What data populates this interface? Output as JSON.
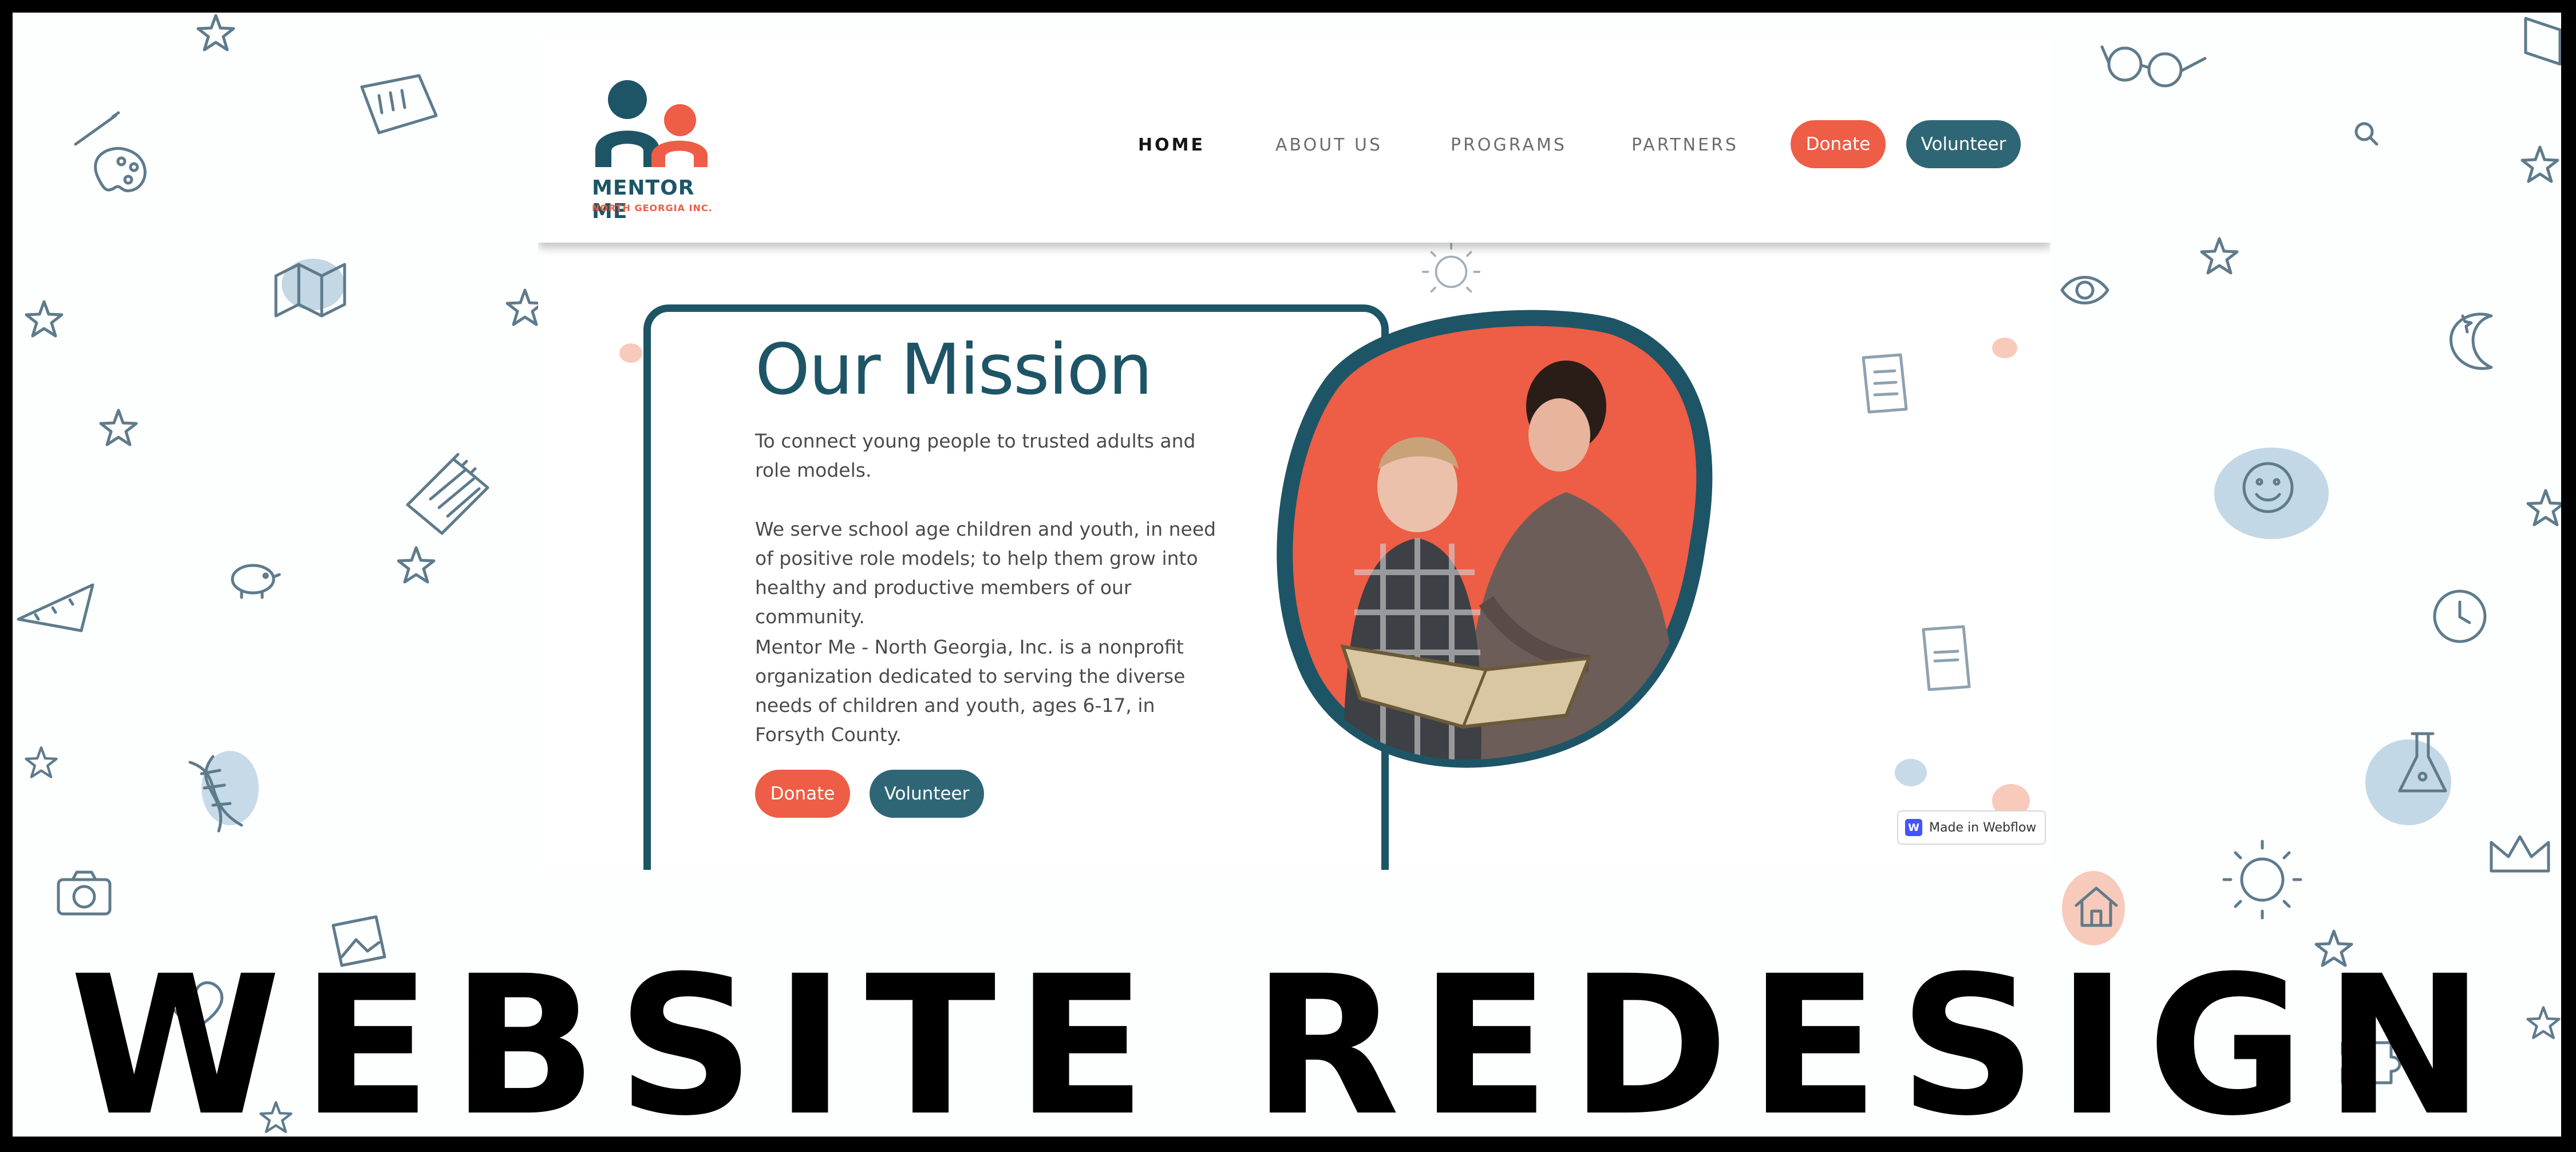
{
  "colors": {
    "frame": "#000000",
    "teal": "#1d5566",
    "teal_button": "#2f6675",
    "coral": "#ee5d45",
    "doodle_stroke": "#5e7b8c"
  },
  "site": {
    "logo": {
      "title": "MENTOR ME",
      "subtitle": "NORTH GEORGIA INC."
    },
    "nav": {
      "links": [
        {
          "label": "HOME",
          "active": true
        },
        {
          "label": "ABOUT US",
          "active": false
        },
        {
          "label": "PROGRAMS",
          "active": false
        },
        {
          "label": "PARTNERS",
          "active": false
        }
      ],
      "donate_label": "Donate",
      "volunteer_label": "Volunteer"
    },
    "mission": {
      "title": "Our Mission",
      "paragraphs": [
        "To connect young people to trusted adults and role models.",
        "We serve school age children and youth, in need of positive role models; to help them grow into healthy and productive members of our community.",
        "Mentor Me - North Georgia, Inc. is a nonprofit organization dedicated to serving the diverse needs of children and youth, ages 6-17, in Forsyth County."
      ],
      "donate_label": "Donate",
      "volunteer_label": "Volunteer"
    },
    "badge": {
      "icon": "W",
      "label": "Made in Webflow"
    }
  },
  "banner": {
    "title": "WEBSITE REDESIGN"
  },
  "icons": [
    "palette-icon",
    "map-icon",
    "dna-icon",
    "camera-icon",
    "heart-icon",
    "photo-icon",
    "notepad-icon",
    "piggy-bank-icon",
    "ruler-triangle-icon",
    "star-icon",
    "glasses-icon",
    "eye-icon",
    "moon-icon",
    "smiley-icon",
    "clock-icon",
    "flask-icon",
    "sun-icon",
    "crown-icon",
    "puzzle-icon",
    "house-icon",
    "test-paper-icon",
    "book-icon"
  ]
}
